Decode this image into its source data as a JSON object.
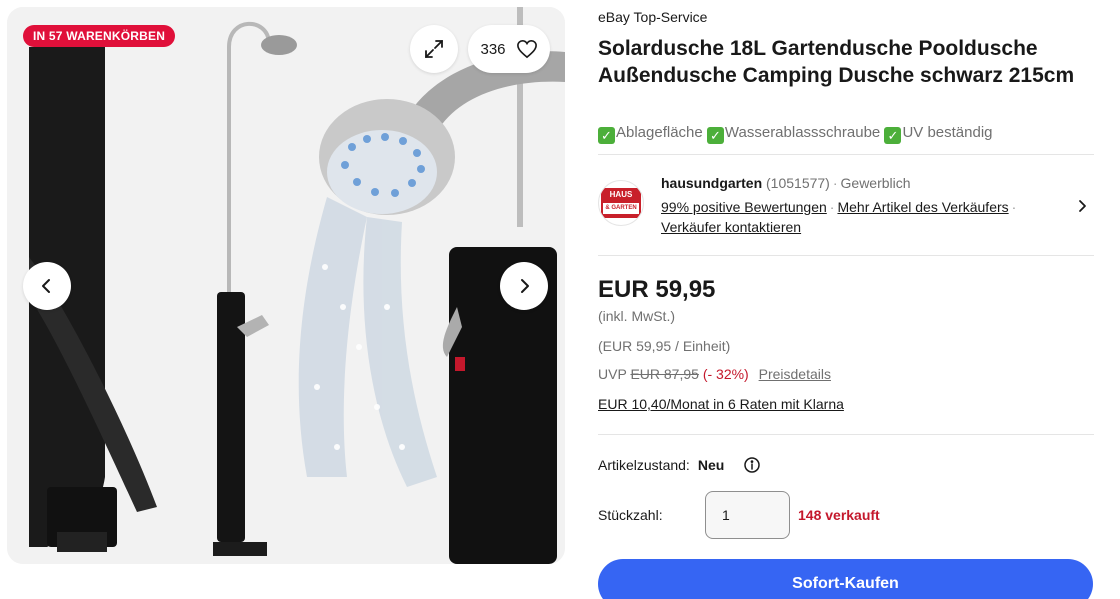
{
  "gallery": {
    "badge": "IN 57 WARENKÖRBEN",
    "watch_count": "336",
    "icons": [
      "expand-icon",
      "heart-icon",
      "chevron-left-icon",
      "chevron-right-icon"
    ]
  },
  "listing": {
    "top_service": "eBay Top-Service",
    "title": "Solardusche 18L Gartendusche Pooldusche Außendusche Camping Dusche schwarz 215cm",
    "features": [
      "Ablagefläche",
      "Wasserablassschraube",
      "UV beständig"
    ]
  },
  "seller": {
    "name": "hausundgarten",
    "feedback_count": "(1051577)",
    "type": "Gewerblich",
    "positive": "99% positive Bewertungen",
    "more_items": "Mehr Artikel des Verkäufers",
    "contact": "Verkäufer kontaktieren",
    "logo_top": "HAUS",
    "logo_bottom": "& GARTEN"
  },
  "pricing": {
    "price": "EUR 59,95",
    "vat": "(inkl. MwSt.)",
    "unit_price": "(EUR 59,95 / Einheit)",
    "uvp_label": "UVP",
    "uvp_value": "EUR 87,95",
    "discount": "(- 32%)",
    "price_details": "Preisdetails",
    "klarna": "EUR 10,40/Monat in 6 Raten mit Klarna"
  },
  "purchase": {
    "condition_label": "Artikelzustand:",
    "condition_value": "Neu",
    "quantity_label": "Stückzahl:",
    "quantity_value": "1",
    "sold": "148 verkauft",
    "buy_now": "Sofort-Kaufen"
  },
  "colors": {
    "badge": "#e0103a",
    "buy_button": "#3665f3",
    "alert_red": "#c4182c",
    "check_green": "#4caf3a"
  }
}
